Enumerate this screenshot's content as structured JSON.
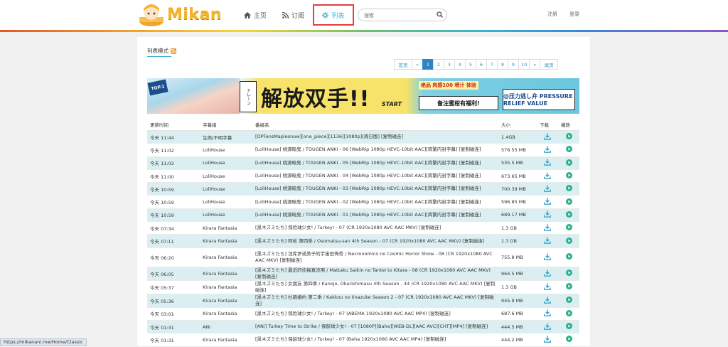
{
  "header": {
    "logo_text": "Mikan",
    "nav": [
      {
        "label": "主页",
        "icon": "home-icon"
      },
      {
        "label": "订阅",
        "icon": "rss-icon"
      },
      {
        "label": "列表",
        "icon": "gear-icon"
      }
    ],
    "search_placeholder": "搜索",
    "login_label": "注册",
    "register_label": "登录",
    "accent_color": "#3ab0d8",
    "highlight_box_color": "#e04040"
  },
  "panel": {
    "mode_title": "列表模式"
  },
  "pager": {
    "first": "首页",
    "prev": "«",
    "pages": [
      "1",
      "2",
      "3",
      "4",
      "5",
      "6",
      "7",
      "8",
      "9",
      "10"
    ],
    "active": "1",
    "next": "»",
    "last": "尾页"
  },
  "banner": {
    "top_badge": "TOP.1",
    "side_text": "ドレーン",
    "headline": "解放双手!!",
    "start": "START",
    "promo": "绝品 肉感100 喷汁 体验",
    "note": "备注蜜柑有福利!",
    "brand": "@压力逃し弁 PRESSURE RELIEF VALUE"
  },
  "table": {
    "headers": [
      "更新时间",
      "字幕组",
      "番组名",
      "大小",
      "下载",
      "播放"
    ],
    "rows": [
      {
        "time": "今天 11:44",
        "group": "生肉/不明字幕",
        "name": "[OPFansMaplesnow][one_piece][1136][1080p][周日版] [复制磁连]",
        "size": "1.4GB"
      },
      {
        "time": "今天 11:02",
        "group": "LoliHouse",
        "name": "[LoliHouse] 桃源暗鬼 / TOUGEN ANKI - 06 [WebRip 1080p HEVC-10bit AAC][简繁内封字幕] [复制磁连]",
        "size": "576.55 MB"
      },
      {
        "time": "今天 11:02",
        "group": "LoliHouse",
        "name": "[LoliHouse] 桃源暗鬼 / TOUGEN ANKI - 05 [WebRip 1080p HEVC-10bit AAC][简繁内封字幕] [复制磁连]",
        "size": "535.5 MB"
      },
      {
        "time": "今天 11:00",
        "group": "LoliHouse",
        "name": "[LoliHouse] 桃源暗鬼 / TOUGEN ANKI - 04 [WebRip 1080p HEVC-10bit AAC][简繁内封字幕] [复制磁连]",
        "size": "673.65 MB"
      },
      {
        "time": "今天 10:59",
        "group": "LoliHouse",
        "name": "[LoliHouse] 桃源暗鬼 / TOUGEN ANKI - 03 [WebRip 1080p HEVC-10bit AAC][简繁内封字幕] [复制磁连]",
        "size": "700.39 MB"
      },
      {
        "time": "今天 10:59",
        "group": "LoliHouse",
        "name": "[LoliHouse] 桃源暗鬼 / TOUGEN ANKI - 02 [WebRip 1080p HEVC-10bit AAC][简繁内封字幕] [复制磁连]",
        "size": "596.85 MB"
      },
      {
        "time": "今天 10:59",
        "group": "LoliHouse",
        "name": "[LoliHouse] 桃源暗鬼 / TOUGEN ANKI - 01 [WebRip 1080p HEVC-10bit AAC][简繁内封字幕] [复制磁连]",
        "size": "689.17 MB"
      },
      {
        "time": "今天 07:34",
        "group": "Kirara Fantasia",
        "name": "[黒ネズミたち] 保险球少女! / Turkey! - 07 (CR 1920x1080 AVC AAC MKV) [复制磁连]",
        "size": "1.3 GB"
      },
      {
        "time": "今天 07:11",
        "group": "Kirara Fantasia",
        "name": "[黒ネズミたち] 阿松 第四季 / Osomatsu-san 4th Season - 07 (CR 1920x1080 AVC AAC MKV) [复制磁连]",
        "size": "1.3 GB"
      },
      {
        "time": "今天 06:20",
        "group": "Kirara Fantasia",
        "name": "[黒ネズミたち] 涅库罗诺美子的宇宙恐怖秀 / Necronomico no Cosmic Horror Show - 08 (CR 1920x1080 AVC AAC MKV) [复制磁连]",
        "size": "755.8 MB"
      },
      {
        "time": "今天 06:05",
        "group": "Kirara Fantasia",
        "name": "[黒ネズミたち] 最近的侦探真没用 / Mattaku Saikin no Tantei to Kitara - 08 (CR 1920x1080 AVC AAC MKV) [复制磁连]",
        "size": "964.5 MB"
      },
      {
        "time": "今天 05:37",
        "group": "Kirara Fantasia",
        "name": "[黒ネズミたち] 女朋友 第四季 / Kanojo, Okarishimasu 4th Season - 44 (CR 1920x1080 AVC AAC MKV) [复制磁连]",
        "size": "1.3 GB"
      },
      {
        "time": "今天 05:36",
        "group": "Kirara Fantasia",
        "name": "[黒ネズミたち] 杜鹃婚约 第二季 / Kakkou no Iinazuke Season 2 - 07 (CR 1920x1080 AVC AAC MKV) [复制磁连]",
        "size": "945.9 MB"
      },
      {
        "time": "今天 03:01",
        "group": "Kirara Fantasia",
        "name": "[黒ネズミたち] 保险球少女! / Turkey! - 07 (ABEMA 1920x1080 AVC AAC MP4) [复制磁连]",
        "size": "687.6 MB"
      },
      {
        "time": "今天 01:31",
        "group": "ANi",
        "name": "[ANi] Turkey Time to Strike / 保龄球少女! - 07 [1080P][Baha][WEB-DL][AAC AVC][CHT][MP4] [复制磁连]",
        "size": "444.5 MB"
      },
      {
        "time": "今天 01:31",
        "group": "Kirara Fantasia",
        "name": "[黒ネズミたち] 保龄球少女! / Turkey! - 07 (Baha 1920x1080 AVC AAC MP4) [复制磁连]",
        "size": "444.2 MB"
      }
    ]
  },
  "statusbar": {
    "url": "https://mikanani.me/Home/Classic"
  }
}
